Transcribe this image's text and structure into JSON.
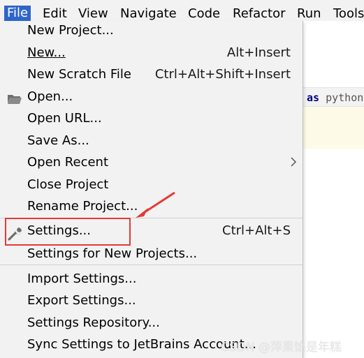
{
  "menubar": {
    "items": [
      {
        "label": "File"
      },
      {
        "label": "Edit"
      },
      {
        "label": "View"
      },
      {
        "label": "Navigate"
      },
      {
        "label": "Code"
      },
      {
        "label": "Refactor"
      },
      {
        "label": "Run"
      },
      {
        "label": "Tools"
      }
    ]
  },
  "editor": {
    "code_keyword": "as",
    "code_module": "python"
  },
  "file_menu": {
    "new_project": "New Project...",
    "new": {
      "label": "New...",
      "shortcut": "Alt+Insert"
    },
    "new_scratch": {
      "label": "New Scratch File",
      "shortcut": "Ctrl+Alt+Shift+Insert"
    },
    "open": "Open...",
    "open_url": "Open URL...",
    "save_as": "Save As...",
    "open_recent": "Open Recent",
    "close_project": "Close Project",
    "rename_project": "Rename Project...",
    "settings": {
      "label": "Settings...",
      "shortcut": "Ctrl+Alt+S"
    },
    "settings_new_projects": "Settings for New Projects...",
    "import_settings": "Import Settings...",
    "export_settings": "Export Settings...",
    "settings_repository": "Settings Repository...",
    "sync_settings": "Sync Settings to JetBrains Account..."
  },
  "watermark": "CSDN @萍果馅是年糕",
  "colors": {
    "menu_bg": "#f2f2f2",
    "active_menu": "#2f65ca",
    "annotation": "#e53935"
  },
  "icons": {
    "open": "folder-icon",
    "settings": "wrench-icon",
    "open_recent": "chevron-right-icon"
  }
}
